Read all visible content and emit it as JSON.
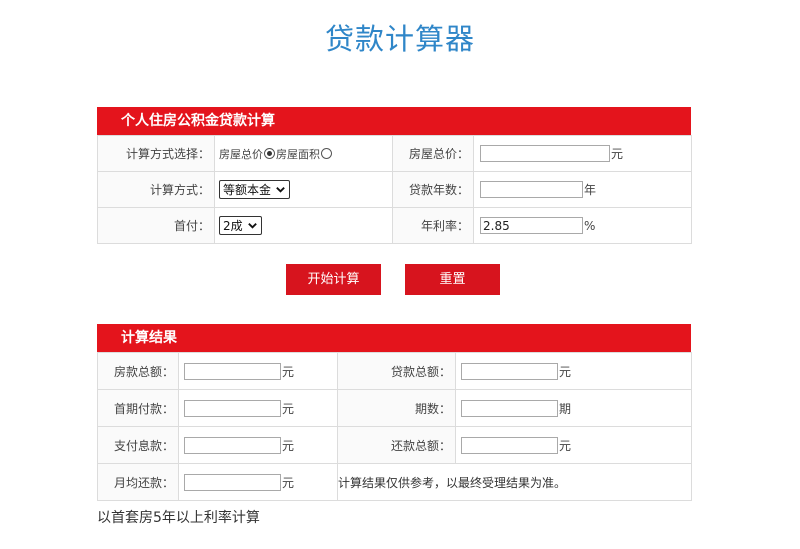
{
  "page_title": "贷款计算器",
  "loan_section": {
    "header": "个人住房公积金贷款计算",
    "calc_mode_label": "计算方式选择：",
    "radio_total_price": "房屋总价",
    "radio_area": "房屋面积",
    "selected_mode": "total_price",
    "house_total_label": "房屋总价：",
    "house_total_value": "",
    "house_total_unit": "元",
    "method_label": "计算方式：",
    "method_value": "等额本金",
    "years_label": "贷款年数：",
    "years_value": "",
    "years_unit": "年",
    "down_label": "首付：",
    "down_value": "2成",
    "rate_label": "年利率：",
    "rate_value": "2.85",
    "rate_unit": "%"
  },
  "buttons": {
    "start": "开始计算",
    "reset": "重置"
  },
  "result_section": {
    "header": "计算结果",
    "rows": [
      {
        "l1": "房款总额：",
        "v1": "",
        "u1": "元",
        "l2": "贷款总额：",
        "v2": "",
        "u2": "元"
      },
      {
        "l1": "首期付款：",
        "v1": "",
        "u1": "元",
        "l2": "期数：",
        "v2": "",
        "u2": "期"
      },
      {
        "l1": "支付息款：",
        "v1": "",
        "u1": "元",
        "l2": "还款总额：",
        "v2": "",
        "u2": "元"
      }
    ],
    "monthly_label": "月均还款：",
    "monthly_value": "",
    "monthly_unit": "元",
    "note": "计算结果仅供参考，以最终受理结果为准。"
  },
  "footnote": "以首套房5年以上利率计算",
  "colors": {
    "title": "#2f86c8",
    "header_bg": "#e4141c",
    "button_bg": "#d7141e"
  }
}
